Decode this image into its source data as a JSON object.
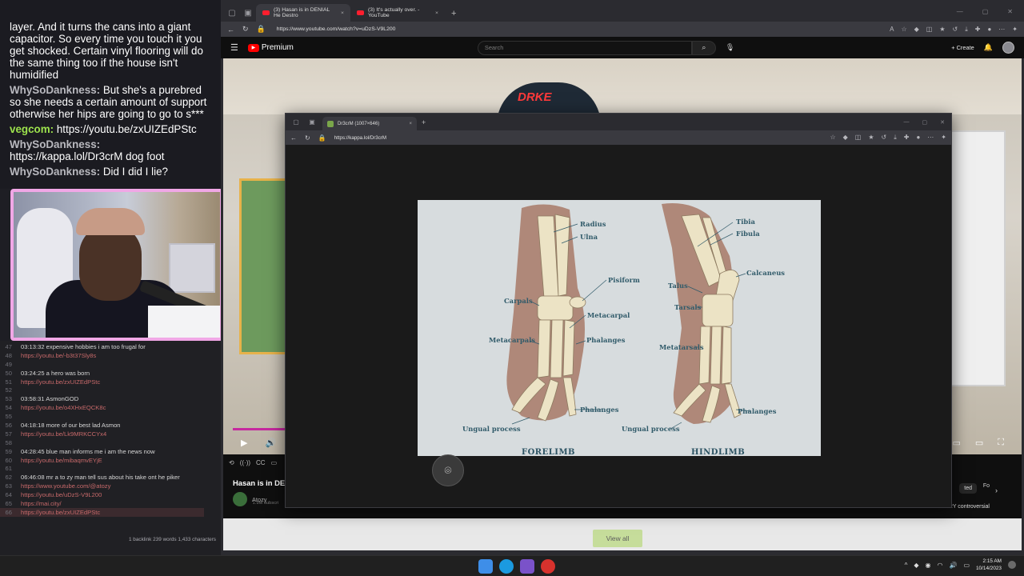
{
  "chat": {
    "messages": [
      {
        "user": "",
        "text": "layer. And it turns the cans into a giant capacitor. So every time you touch it you get shocked. Certain vinyl flooring will do the same thing too if the house isn't humidified"
      },
      {
        "user": "WhySoDankness:",
        "text": "But she's a purebred so she needs a certain amount of support otherwise her hips are going to go to s***"
      },
      {
        "user": "vegcom:",
        "text": "https://youtu.be/zxUIZEdPStc",
        "green": true
      },
      {
        "user": "WhySoDankness:",
        "text": "https://kappa.lol/Dr3crM dog foot"
      },
      {
        "user": "WhySoDankness:",
        "text": "Did I did I lie?"
      }
    ]
  },
  "notes": {
    "lines": [
      {
        "n": "47",
        "t": "03:13:32 expensive hobbies i am too frugal for",
        "link": false
      },
      {
        "n": "48",
        "t": "https://youtu.be/-b3t37Sly8s",
        "link": true
      },
      {
        "n": "49",
        "t": "",
        "link": false
      },
      {
        "n": "50",
        "t": "03:24:25 a hero was born",
        "link": false
      },
      {
        "n": "51",
        "t": "https://youtu.be/zxUIZEdPStc",
        "link": true
      },
      {
        "n": "52",
        "t": "",
        "link": false
      },
      {
        "n": "53",
        "t": "03:58:31 AsmonGOD",
        "link": false
      },
      {
        "n": "54",
        "t": "https://youtu.be/o4XHxEQCK8c",
        "link": true
      },
      {
        "n": "55",
        "t": "",
        "link": false
      },
      {
        "n": "56",
        "t": "04:18:18 more of our best lad Asmon",
        "link": false
      },
      {
        "n": "57",
        "t": "https://youtu.be/Lk9MRKCCYx4",
        "link": true
      },
      {
        "n": "58",
        "t": "",
        "link": false
      },
      {
        "n": "59",
        "t": "04:28:45 blue man informs me i am the news now",
        "link": false
      },
      {
        "n": "60",
        "t": "https://youtu.be/mibaqmvEYjE",
        "link": true
      },
      {
        "n": "61",
        "t": "",
        "link": false
      },
      {
        "n": "62",
        "t": "06:46:08 mr a to zy man tell sus about his take ont he piker",
        "link": false
      },
      {
        "n": "63",
        "t": "https://www.youtube.com/@atozy",
        "link": true
      },
      {
        "n": "64",
        "t": "https://youtu.be/uDzS-V9L200",
        "link": true
      },
      {
        "n": "65",
        "t": "https://mai.city/",
        "link": true
      },
      {
        "n": "66",
        "t": "https://youtu.be/zxUIZEdPStc",
        "link": true,
        "highlight": true
      }
    ],
    "status": "1 backlink   239 words   1,433 characters"
  },
  "browser": {
    "tabs": [
      {
        "label": "(3) Hasan is in DENIAL He Destro",
        "active": true
      },
      {
        "label": "(3) It's actually over. - YouTube",
        "active": false
      }
    ],
    "url": "https://www.youtube.com/watch?v=uDzS-V9L200"
  },
  "youtube": {
    "logo": "Premium",
    "search_placeholder": "Search",
    "create": "Create",
    "video_title": "Hasan is in DE",
    "channel": "Atozy",
    "subs": "1.9M subscri",
    "chip1": "ted",
    "chip2": "Fo",
    "side_item": "This is a VERY controversial",
    "view_all": "View all"
  },
  "popup": {
    "tab_label": "Dr3crM (1007×646)",
    "url": "https://kappa.lol/Dr3crM"
  },
  "figure": {
    "forelimb_labels": {
      "radius": "Radius",
      "ulna": "Ulna",
      "pisiform": "Pisiform",
      "carpals": "Carpals",
      "metacarpal": "Metacarpal",
      "metacarpals": "Metacarpals",
      "phalanges1": "Phalanges",
      "phalanges2": "Phalanges",
      "ungual": "Ungual process"
    },
    "hindlimb_labels": {
      "tibia": "Tibia",
      "fibula": "Fibula",
      "calcaneus": "Calcaneus",
      "talus": "Talus",
      "tarsals": "Tarsals",
      "metatarsals": "Metatarsals",
      "phalanges": "Phalanges",
      "ungual": "Ungual process"
    },
    "caption_left": "FORELIMB",
    "caption_right": "HINDLIMB",
    "colors": {
      "bg": "#d7dcde",
      "bone": "#ece3c5",
      "shadow": "#a5735f",
      "label": "#315b6a"
    }
  },
  "taskbar": {
    "time": "2:15 AM",
    "date": "10/14/2023"
  }
}
